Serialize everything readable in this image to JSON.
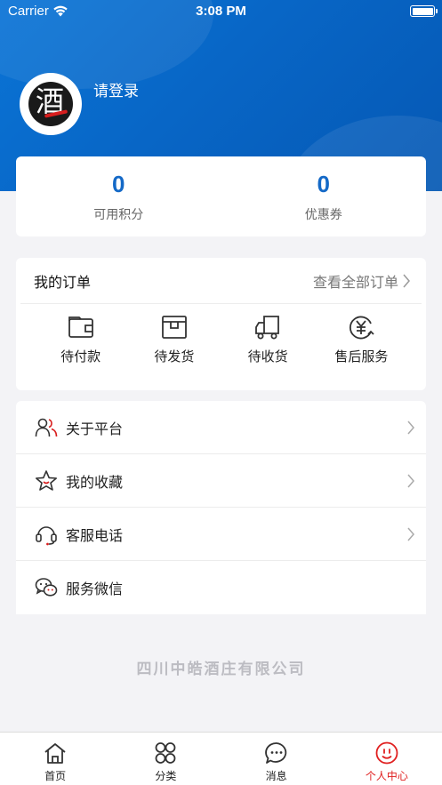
{
  "status_bar": {
    "carrier": "Carrier",
    "time": "3:08 PM"
  },
  "profile": {
    "login_text": "请登录",
    "avatar_glyph": "酒"
  },
  "points": [
    {
      "value": "0",
      "label": "可用积分"
    },
    {
      "value": "0",
      "label": "优惠券"
    }
  ],
  "orders": {
    "title": "我的订单",
    "view_all": "查看全部订单",
    "items": [
      {
        "label": "待付款",
        "icon": "wallet-icon"
      },
      {
        "label": "待发货",
        "icon": "package-icon"
      },
      {
        "label": "待收货",
        "icon": "truck-icon"
      },
      {
        "label": "售后服务",
        "icon": "yuan-refund-icon"
      }
    ]
  },
  "menu": [
    {
      "label": "关于平台",
      "icon": "users-icon"
    },
    {
      "label": "我的收藏",
      "icon": "star-icon"
    },
    {
      "label": "客服电话",
      "icon": "headset-icon"
    },
    {
      "label": "服务微信",
      "icon": "wechat-icon"
    }
  ],
  "footer": {
    "company": "四川中皓酒庄有限公司"
  },
  "tabbar": {
    "items": [
      {
        "label": "首页",
        "icon": "home-icon"
      },
      {
        "label": "分类",
        "icon": "category-icon"
      },
      {
        "label": "消息",
        "icon": "message-icon"
      },
      {
        "label": "个人中心",
        "icon": "profile-smile-icon"
      }
    ],
    "active_index": 3
  },
  "colors": {
    "brand_blue": "#0a6fd0",
    "points_blue": "#1469c7",
    "active_red": "#e02020"
  }
}
